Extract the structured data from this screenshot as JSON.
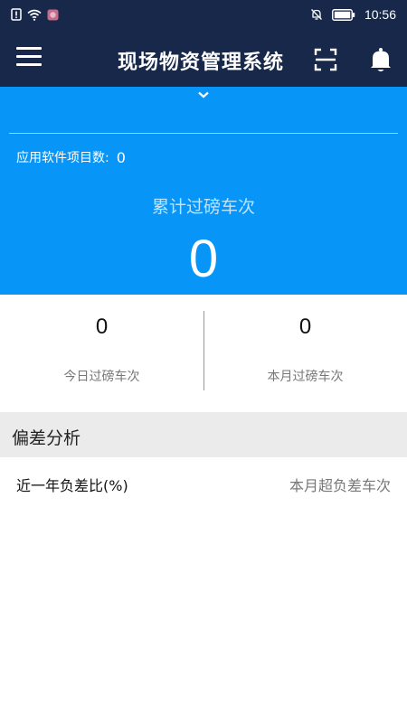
{
  "status_bar": {
    "time": "10:56",
    "icons": [
      "alert-icon",
      "wifi-icon",
      "app-notification-icon",
      "silent-bell-icon",
      "battery-icon"
    ]
  },
  "app_bar": {
    "title": "现场物资管理系统",
    "icons": [
      "menu-icon",
      "scan-icon",
      "bell-icon"
    ]
  },
  "hero": {
    "expand_icon": "chevron-down-icon",
    "project_count_label": "应用软件项目数:",
    "project_count_value": "0",
    "total_label": "累计过磅车次",
    "total_value": "0"
  },
  "stats": {
    "today_value": "0",
    "today_label": "今日过磅车次",
    "month_value": "0",
    "month_label": "本月过磅车次"
  },
  "deviation": {
    "section_title": "偏差分析",
    "year_ratio_label": "近一年负差比(%)",
    "month_over_label": "本月超负差车次"
  },
  "colors": {
    "app_bar": "#17284b",
    "hero_blue": "#0795f7",
    "section_gray": "#ebebeb"
  }
}
